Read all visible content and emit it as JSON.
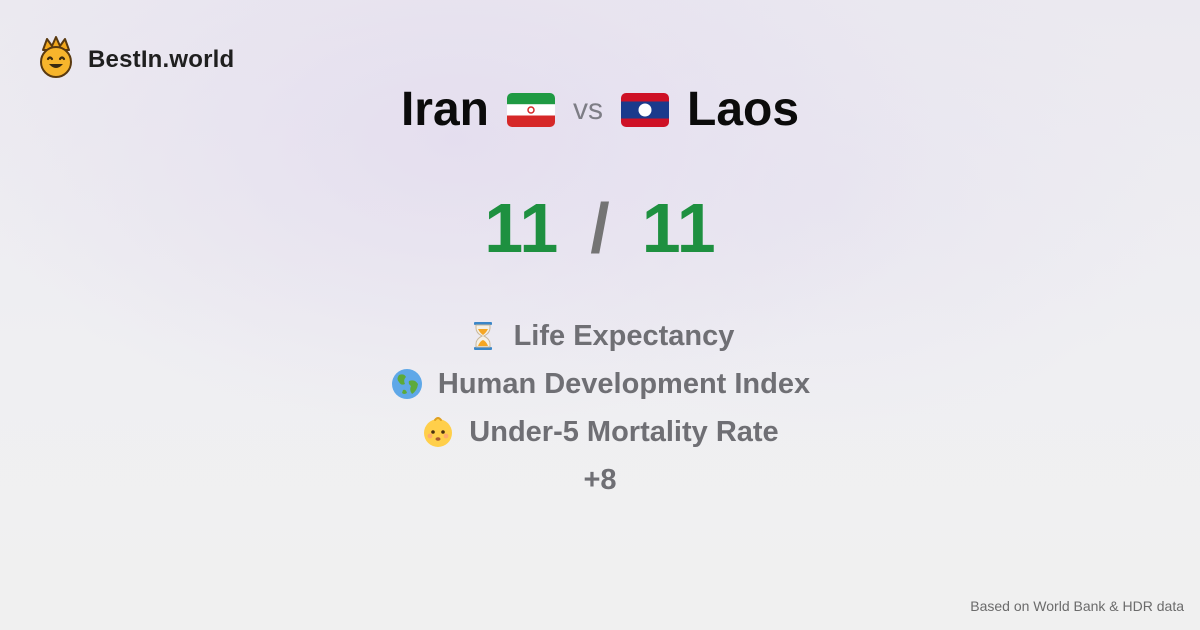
{
  "brand": {
    "name": "BestIn.world",
    "icon": "king-smiley-logo"
  },
  "comparison": {
    "country_a": "Iran",
    "flag_a": "iran-flag-icon",
    "separator": "vs",
    "country_b": "Laos",
    "flag_b": "laos-flag-icon"
  },
  "score": {
    "a": "11",
    "separator": "/",
    "b": "11",
    "color": "#1e9040"
  },
  "metrics": [
    {
      "label": "Life Expectancy",
      "icon": "hourglass-icon"
    },
    {
      "label": "Human Development Index",
      "icon": "globe-icon"
    },
    {
      "label": "Under-5 Mortality Rate",
      "icon": "baby-icon"
    }
  ],
  "more": "+8",
  "footer": {
    "source": "Based on World Bank & HDR data"
  }
}
